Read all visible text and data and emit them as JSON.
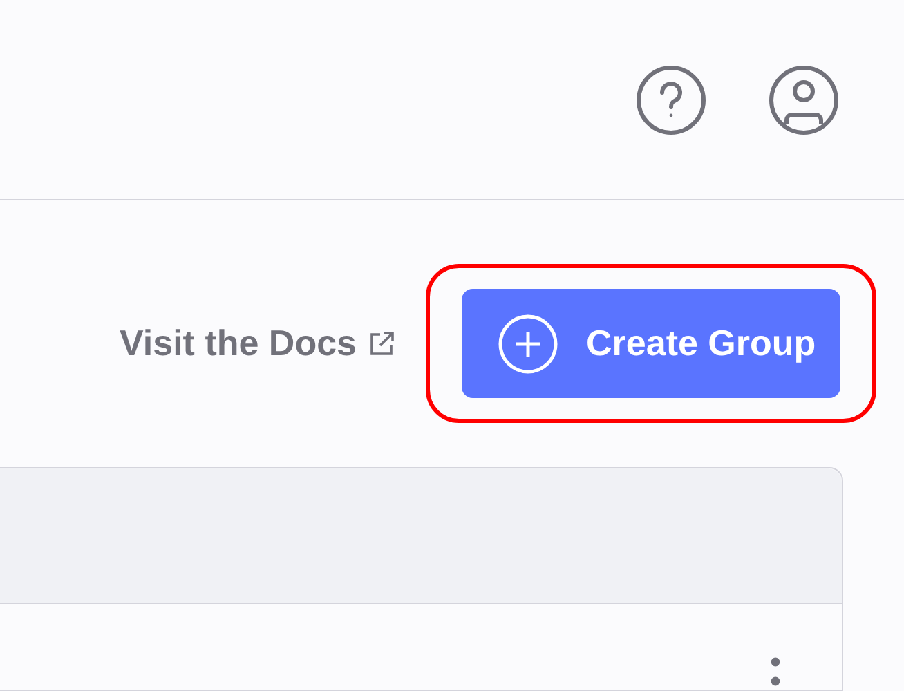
{
  "docs_link": {
    "label": "Visit the Docs"
  },
  "create_button": {
    "label": "Create Group",
    "highlighted": true
  }
}
